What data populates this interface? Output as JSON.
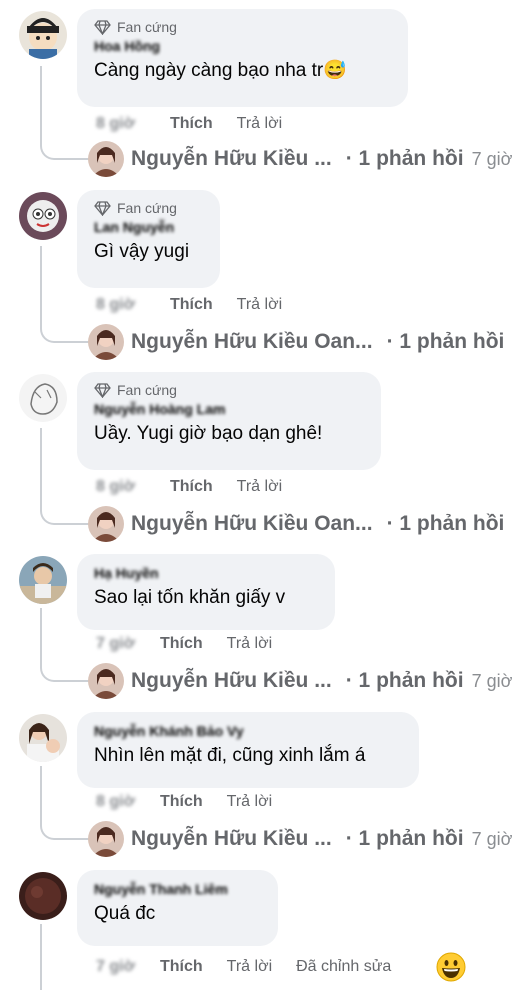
{
  "badge_label": "Fan cứng",
  "comments": [
    {
      "author": "Hoa Hồng",
      "text": "Càng ngày càng bạo nha tr😅",
      "time": "8 giờ",
      "like": "Thích",
      "reply": "Trả lời",
      "replies": {
        "name": "Nguyễn Hữu Kiều ...",
        "count": "· 1 phản hồi",
        "time": "7 giờ"
      }
    },
    {
      "author": "Lan Nguyễn",
      "text": "Gì vậy yugi",
      "time": "8 giờ",
      "like": "Thích",
      "reply": "Trả lời",
      "replies": {
        "name": "Nguyễn Hữu Kiều Oan...",
        "count": "· 1 phản hồi",
        "time": ""
      }
    },
    {
      "author": "Nguyễn Hoàng Lam",
      "text": "Uầy. Yugi giờ bạo dạn ghê!",
      "time": "8 giờ",
      "like": "Thích",
      "reply": "Trả lời",
      "replies": {
        "name": "Nguyễn Hữu Kiều Oan...",
        "count": "· 1 phản hồi",
        "time": ""
      }
    },
    {
      "author": "Hạ Huyền",
      "text": "Sao lại tốn khăn giấy v",
      "time": "7 giờ",
      "like": "Thích",
      "reply": "Trả lời",
      "replies": {
        "name": "Nguyễn Hữu Kiều ...",
        "count": "· 1 phản hồi",
        "time": "7 giờ"
      }
    },
    {
      "author": "Nguyễn Khánh Bảo Vy",
      "text": "Nhìn lên mặt đi, cũng xinh lắm á",
      "time": "8 giờ",
      "like": "Thích",
      "reply": "Trả lời",
      "replies": {
        "name": "Nguyễn Hữu Kiều ...",
        "count": "· 1 phản hồi",
        "time": "7 giờ"
      }
    },
    {
      "author": "Nguyễn Thanh Liêm",
      "text": "Quá đc",
      "time": "7 giờ",
      "like": "Thích",
      "reply": "Trả lời",
      "edited": "Đã chỉnh sửa"
    }
  ],
  "colors": {
    "bubble": "#f0f2f5",
    "secondary_text": "#65676b",
    "thread_line": "#ccd0d5"
  },
  "icons": [
    "diamond-icon",
    "grinning-emoji-icon"
  ]
}
